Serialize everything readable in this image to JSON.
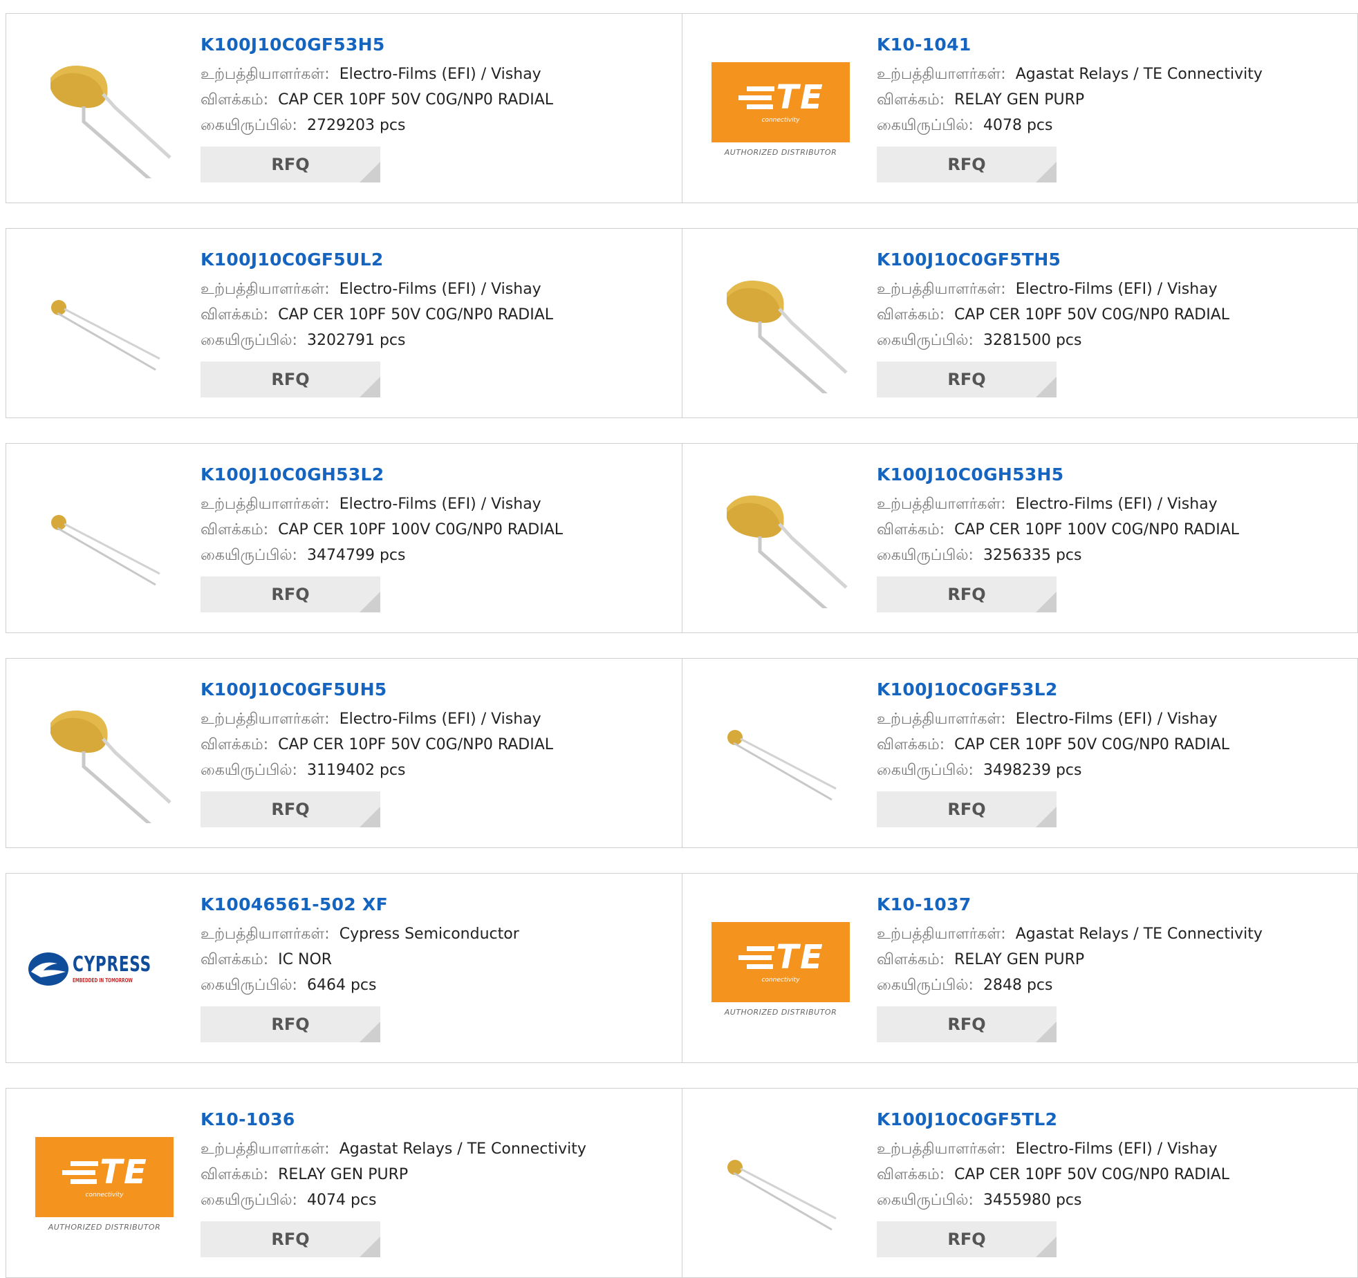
{
  "labels": {
    "manufacturer": "உற்பத்தியாளர்கள்:",
    "description": "விளக்கம்:",
    "stock": "கையிருப்பில்:",
    "rfq": "RFQ"
  },
  "colors": {
    "link": "#1565c0",
    "te_orange": "#f4931e",
    "capacitor_body": "#d6a93a",
    "cypress_blue": "#0f4c9a"
  },
  "logos": {
    "te": {
      "name": "TE",
      "sub": "connectivity",
      "badge": "AUTHORIZED DISTRIBUTOR"
    },
    "cypress": {
      "name": "CYPRESS",
      "tagline": "EMBEDDED IN TOMORROW"
    }
  },
  "products": [
    {
      "part": "K100J10C0GF53H5",
      "manufacturer": "Electro-Films (EFI) / Vishay",
      "description": "CAP CER 10PF 50V C0G/NP0 RADIAL",
      "stock": "2729203 pcs",
      "image": "capacitor-large"
    },
    {
      "part": "K10-1041",
      "manufacturer": "Agastat Relays / TE Connectivity",
      "description": "RELAY GEN PURP",
      "stock": "4078 pcs",
      "image": "te-logo"
    },
    {
      "part": "K100J10C0GF5UL2",
      "manufacturer": "Electro-Films (EFI) / Vishay",
      "description": "CAP CER 10PF 50V C0G/NP0 RADIAL",
      "stock": "3202791 pcs",
      "image": "capacitor-small"
    },
    {
      "part": "K100J10C0GF5TH5",
      "manufacturer": "Electro-Films (EFI) / Vishay",
      "description": "CAP CER 10PF 50V C0G/NP0 RADIAL",
      "stock": "3281500 pcs",
      "image": "capacitor-large"
    },
    {
      "part": "K100J10C0GH53L2",
      "manufacturer": "Electro-Films (EFI) / Vishay",
      "description": "CAP CER 10PF 100V C0G/NP0 RADIAL",
      "stock": "3474799 pcs",
      "image": "capacitor-small"
    },
    {
      "part": "K100J10C0GH53H5",
      "manufacturer": "Electro-Films (EFI) / Vishay",
      "description": "CAP CER 10PF 100V C0G/NP0 RADIAL",
      "stock": "3256335 pcs",
      "image": "capacitor-large"
    },
    {
      "part": "K100J10C0GF5UH5",
      "manufacturer": "Electro-Films (EFI) / Vishay",
      "description": "CAP CER 10PF 50V C0G/NP0 RADIAL",
      "stock": "3119402 pcs",
      "image": "capacitor-large"
    },
    {
      "part": "K100J10C0GF53L2",
      "manufacturer": "Electro-Films (EFI) / Vishay",
      "description": "CAP CER 10PF 50V C0G/NP0 RADIAL",
      "stock": "3498239 pcs",
      "image": "capacitor-small"
    },
    {
      "part": "K10046561-502 XF",
      "manufacturer": "Cypress Semiconductor",
      "description": "IC NOR",
      "stock": "6464 pcs",
      "image": "cypress-logo"
    },
    {
      "part": "K10-1037",
      "manufacturer": "Agastat Relays / TE Connectivity",
      "description": "RELAY GEN PURP",
      "stock": "2848 pcs",
      "image": "te-logo"
    },
    {
      "part": "K10-1036",
      "manufacturer": "Agastat Relays / TE Connectivity",
      "description": "RELAY GEN PURP",
      "stock": "4074 pcs",
      "image": "te-logo"
    },
    {
      "part": "K100J10C0GF5TL2",
      "manufacturer": "Electro-Films (EFI) / Vishay",
      "description": "CAP CER 10PF 50V C0G/NP0 RADIAL",
      "stock": "3455980 pcs",
      "image": "capacitor-small"
    }
  ]
}
